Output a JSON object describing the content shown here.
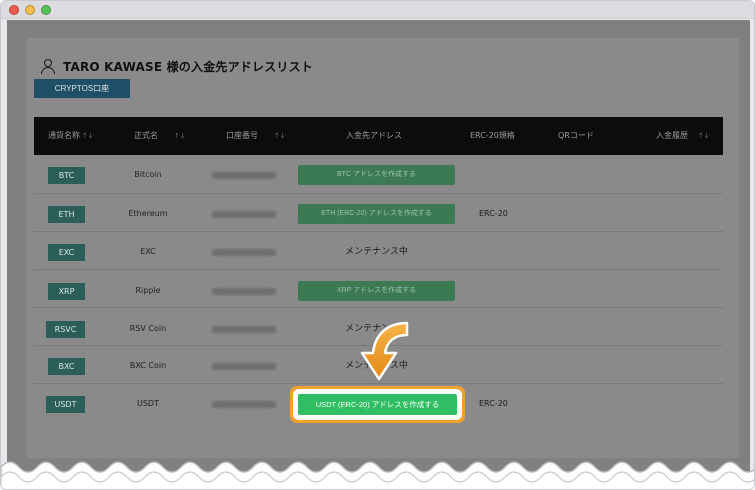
{
  "page": {
    "heading": "TARO KAWASE 様の入金先アドレスリスト",
    "tab_button": "CRYPTOS口座"
  },
  "table": {
    "headers": [
      {
        "label": "通貨名称",
        "sort": "↑↓"
      },
      {
        "label": "正式名",
        "sort": "↑↓"
      },
      {
        "label": "口座番号",
        "sort": "↑↓"
      },
      {
        "label": "入金先アドレス",
        "sort": ""
      },
      {
        "label": "ERC-20規格",
        "sort": ""
      },
      {
        "label": "QRコード",
        "sort": ""
      },
      {
        "label": "入金履歴",
        "sort": "↑↓"
      }
    ],
    "rows": [
      {
        "symbol": "BTC",
        "name": "Bitcoin",
        "address_type": "button",
        "address": "BTC アドレスを作成する",
        "erc": ""
      },
      {
        "symbol": "ETH",
        "name": "Ethereum",
        "address_type": "button",
        "address": "ETH (ERC-20) アドレスを作成する",
        "erc": "ERC-20"
      },
      {
        "symbol": "EXC",
        "name": "EXC",
        "address_type": "text",
        "address": "メンテナンス中",
        "erc": ""
      },
      {
        "symbol": "XRP",
        "name": "Ripple",
        "address_type": "button",
        "address": "XRP アドレスを作成する",
        "erc": ""
      },
      {
        "symbol": "RSVC",
        "name": "RSV Coin",
        "address_type": "text",
        "address": "メンテナンス中",
        "erc": ""
      },
      {
        "symbol": "BXC",
        "name": "BXC Coin",
        "address_type": "text",
        "address": "メンテナンス中",
        "erc": ""
      },
      {
        "symbol": "USDT",
        "name": "USDT",
        "address_type": "highlight",
        "address": "USDT (ERC-20) アドレスを作成する",
        "erc": "ERC-20"
      }
    ]
  },
  "icons": {
    "user": "user-icon",
    "arrow": "arrow-down-icon",
    "window_close": "close-dot-icon",
    "window_minimize": "minimize-dot-icon",
    "window_maximize": "maximize-dot-icon"
  },
  "colors": {
    "header_bg": "#0c0c0c",
    "badge_bg": "#2a5e57",
    "address_button_bg": "#3b7a52",
    "highlight_button_bg": "#2fbf62",
    "highlight_ring": "#f0a12e",
    "arrow": "#f0a12e"
  }
}
